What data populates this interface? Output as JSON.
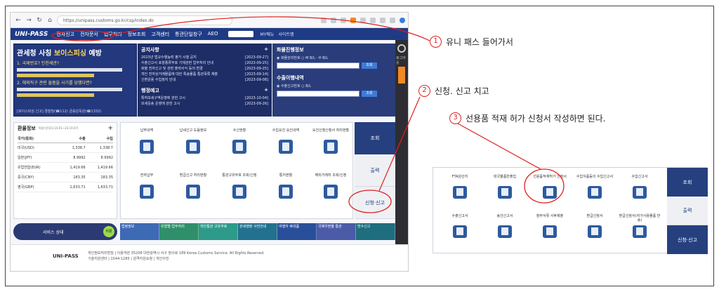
{
  "browser": {
    "url": "https://unipass.customs.go.kr/csp/index.do"
  },
  "site": {
    "logo": "UNI-PASS",
    "menu": [
      "전자신고",
      "전자문서",
      "업무처리",
      "정보조회",
      "고객센터",
      "통관단일창구",
      "AEO"
    ],
    "utils": [
      "MY메뉴",
      "사이트맵"
    ],
    "side_label": "로그아웃"
  },
  "banner": {
    "title_prefix": "관세청 사칭 ",
    "title_em": "보이스피싱",
    "title_suffix": " 예방",
    "q1": "1. 국제번호? 인천세관?",
    "q2": "2. 해외직구 관련 물품을 사기를 당했다면?",
    "footer": "[보이스피싱 신고] 경찰청(☎112) 금융감독원(☎1332)"
  },
  "notice": {
    "title": "공지사항",
    "items": [
      {
        "text": "2023년 법규수행능력 평가 시행 공지",
        "date": "[2023-09-27]"
      },
      {
        "text": "수출신고서 포장종류부호 기재관련 업무처리 안내",
        "date": "[2023-09-25]"
      },
      {
        "text": "화물 전자신고 및 관련 출력서식 등의 변경",
        "date": "[2023-09-25]"
      },
      {
        "text": "개인 전자상거래물품에 대한 특송물품 통관목록 제출",
        "date": "[2023-09-14]"
      },
      {
        "text": "신환운용 수입정지 안내",
        "date": "[2023-09-08]"
      }
    ],
    "title2": "행정예고",
    "items2": [
      {
        "text": "특허보세구역운영에 관한 고시",
        "date": "[2023-10-04]"
      },
      {
        "text": "보세운송 운영에 관한 고시",
        "date": "[2023-09-26]"
      }
    ]
  },
  "cargo": {
    "title": "화물진행정보",
    "radio": "◉ 화물관리번호   ○ M B/L - H B/L",
    "btn": "조회",
    "title2": "수출이행내역",
    "radio2": "◉ 수출신고번호   ○ B/L"
  },
  "fx": {
    "title": "환율정보",
    "period": "적용기간(23.10.01~23.10.07)",
    "headers": [
      "국가(통화)",
      "수출",
      "수입"
    ],
    "rows": [
      [
        "미국(USD)",
        "1,338.7",
        "1,338.7"
      ],
      [
        "일본(JPY)",
        "8.9992",
        "8.9992"
      ],
      [
        "유럽연합(EUR)",
        "1,419.66",
        "1,419.66"
      ],
      [
        "중국(CNY)",
        "183.35",
        "183.35"
      ],
      [
        "영국(GBP)",
        "1,633.71",
        "1,633.71"
      ]
    ]
  },
  "services": [
    "납부내역",
    "납세신고 도움정보",
    "수신현황",
    "수입요건 승인내역",
    "요건신청신청서 처리현황",
    "전자납부",
    "환급신고 처리현황",
    "통관고유부호 조회/신청",
    "통지현황",
    "해외거래처 조회/신청"
  ],
  "tabs": [
    "조회",
    "출력",
    "신청·신고"
  ],
  "servicebar": {
    "label": "서비스 상태",
    "status": "위활"
  },
  "strip": [
    "법령정보",
    "유형별 업무처리",
    "개인통관 고유부호",
    "관세행정 사전안내",
    "여행자 휴대품",
    "국제우편물 통관",
    "방수신고"
  ],
  "footer": {
    "logo": "UNI-PASS",
    "line1": "개인정보처리방침 | 이용약관  35208 대전광역시 서구 청사로 189 Korea Customs Service. All Rights Reserved.",
    "line2": "기술지원센터 | 1544-1285 | 원격지원요청 | 개인이전"
  },
  "inset": {
    "services": [
      "FTA원산지",
      "대국물품반출입",
      "선용품적재허가 신청서",
      "수입식품등의 수입신고서",
      "수입신고서",
      "수출신고서",
      "송선신고서",
      "첨부서류 사후제출",
      "환급신청서",
      "환급신청서(자가사용물품 반송)"
    ],
    "tabs": [
      "조회",
      "출력",
      "신청·신고"
    ]
  },
  "annotations": [
    {
      "num": "1",
      "text": "유니 패스 들어가서"
    },
    {
      "num": "2",
      "text": "신청. 신고 치고"
    },
    {
      "num": "3",
      "text": "선용품 적재 허가 신청서 작성하면 된다."
    }
  ],
  "colors": {
    "navy": "#1f3b85",
    "annotation": "#e02020"
  }
}
